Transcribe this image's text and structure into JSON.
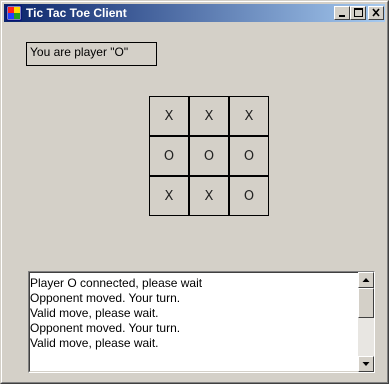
{
  "window": {
    "title": "Tic Tac Toe Client",
    "title_bar_colors": [
      "#0a246a",
      "#a6caf0"
    ],
    "buttons": {
      "minimize_icon": "minimize-icon",
      "maximize_icon": "maximize-icon",
      "close_icon": "close-icon"
    }
  },
  "status": {
    "player_label": "You are player \"O\""
  },
  "board": {
    "cells": [
      "X",
      "X",
      "X",
      "O",
      "O",
      "O",
      "X",
      "X",
      "O"
    ]
  },
  "log": {
    "lines": [
      "Player O connected, please wait",
      "Opponent moved.  Your turn.",
      "Valid move, please wait.",
      "Opponent moved.  Your turn.",
      "Valid move, please wait."
    ]
  }
}
